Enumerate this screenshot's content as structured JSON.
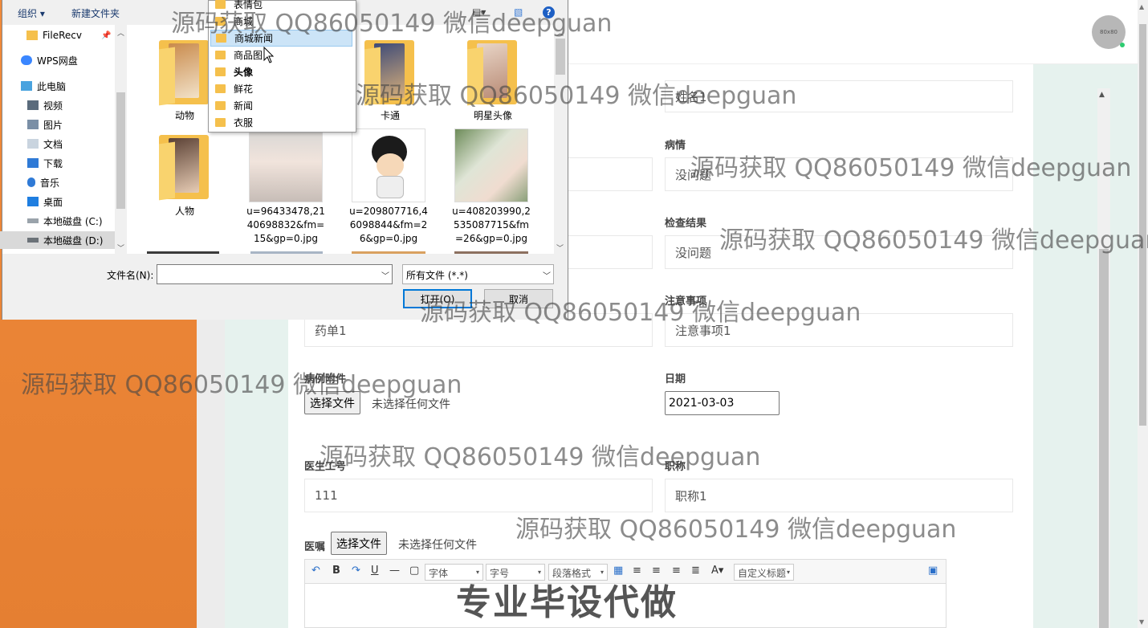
{
  "header": {
    "avatar_text": "80x80"
  },
  "form": {
    "name_value": "姓名1",
    "condition_label": "病情",
    "condition_value": "没问题",
    "exam_label": "检查结果",
    "exam_value": "没问题",
    "notes_label": "注意事项",
    "notes_value": "注意事项1",
    "prescription_value": "药单1",
    "attachment_label": "病例附件",
    "choose_file": "选择文件",
    "no_file": "未选择任何文件",
    "date_label": "日期",
    "date_value": "2021-03-03",
    "doctor_id_label": "医生工号",
    "doctor_id_value": "111",
    "title_label": "职称",
    "title_value": "职称1",
    "advice_label": "医嘱"
  },
  "editor": {
    "font_select": "字体",
    "size_select": "字号",
    "para_select": "段落格式",
    "custom_title": "自定义标题",
    "bold": "B",
    "italic": "I",
    "underline": "U",
    "font_color": "A"
  },
  "dialog": {
    "organize": "组织 ▾",
    "new_folder": "新建文件夹",
    "nav": [
      {
        "label": "FileRecv",
        "icon": "folder-icon"
      },
      {
        "label": "WPS网盘",
        "icon": "cloud-icon"
      },
      {
        "label": "此电脑",
        "icon": "computer-icon"
      },
      {
        "label": "视频",
        "icon": "video-icon"
      },
      {
        "label": "图片",
        "icon": "picture-icon"
      },
      {
        "label": "文档",
        "icon": "document-icon"
      },
      {
        "label": "下载",
        "icon": "download-icon"
      },
      {
        "label": "音乐",
        "icon": "music-icon"
      },
      {
        "label": "桌面",
        "icon": "desktop-icon"
      },
      {
        "label": "本地磁盘 (C:)",
        "icon": "drive-icon"
      },
      {
        "label": "本地磁盘 (D:)",
        "icon": "drive-icon"
      }
    ],
    "files": [
      {
        "label": "动物"
      },
      {
        "label": "卡通"
      },
      {
        "label": "明星头像"
      },
      {
        "label": "人物"
      },
      {
        "label": "u=964334 78,2140698832&fm=15&gp=0.jpg"
      },
      {
        "label": "u=209807716,46098844&fm=26&gp=0.jpg"
      },
      {
        "label": "u=408203990,2535087715&fm=26&gp=0.jpg"
      }
    ],
    "file_label_lines": {
      "f5": [
        "u=96433478,21",
        "40698832&fm=",
        "15&gp=0.jpg"
      ],
      "f6": [
        "u=209807716,4",
        "6098844&fm=2",
        "6&gp=0.jpg"
      ],
      "f7": [
        "u=408203990,2",
        "535087715&fm",
        "=26&gp=0.jpg"
      ]
    },
    "filename_label": "文件名(N):",
    "filename_value": "",
    "filetype_value": "所有文件 (*.*)",
    "open_button": "打开(O)",
    "cancel_button": "取消",
    "dropdown": [
      "表情包",
      "商城",
      "商城新闻",
      "商品图",
      "头像",
      "鲜花",
      "新闻",
      "衣服"
    ]
  },
  "watermarks": {
    "text": "源码获取 QQ86050149 微信deepguan",
    "banner": "专业毕设代做"
  },
  "colors": {
    "sidebar_orange": "#ee8636",
    "mint_background": "#e6f2ee",
    "dialog_selection": "#cce4f7",
    "primary_button_border": "#0078d7"
  }
}
